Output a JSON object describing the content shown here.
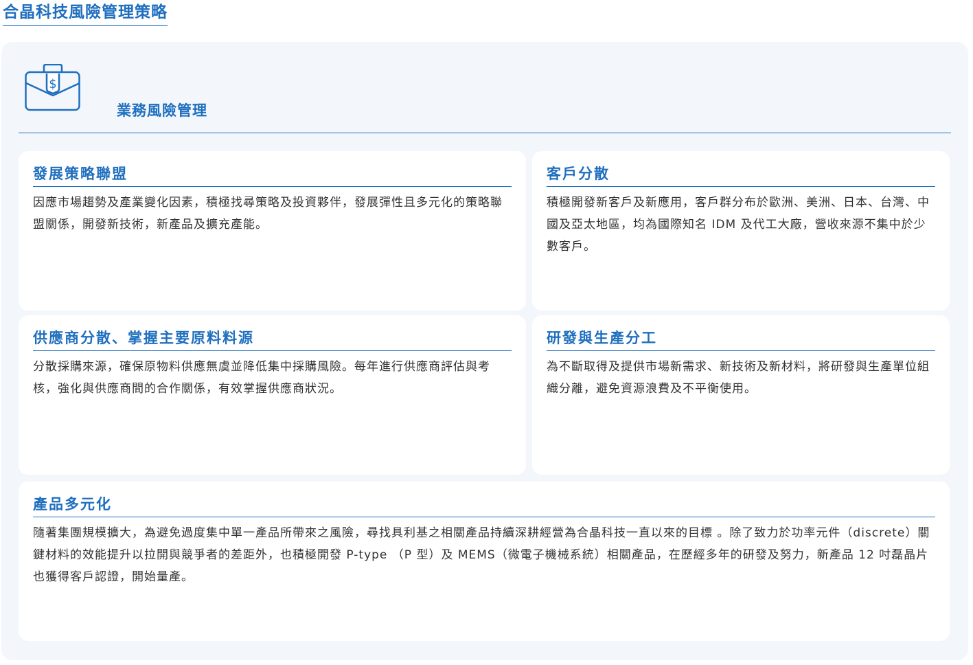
{
  "page": {
    "title": "合晶科技風險管理策略"
  },
  "section": {
    "label": "業務風險管理",
    "icon": "briefcase-dollar-icon"
  },
  "cards": [
    {
      "title": "發展策略聯盟",
      "body": "因應市場趨勢及產業變化因素，積極找尋策略及投資夥伴，發展彈性且多元化的策略聯盟關係，開發新技術，新產品及擴充產能。"
    },
    {
      "title": "客戶分散",
      "body": "積極開發新客戶及新應用，客戶群分布於歐洲、美洲、日本、台灣、中國及亞太地區，均為國際知名 IDM 及代工大廠，營收來源不集中於少數客戶。"
    },
    {
      "title": "供應商分散、掌握主要原料料源",
      "body": "分散採購來源，確保原物料供應無虞並降低集中採購風險。每年進行供應商評估與考核，強化與供應商間的合作關係，有效掌握供應商狀況。"
    },
    {
      "title": "研發與生產分工",
      "body": "為不斷取得及提供市場新需求、新技術及新材料，將研發與生產單位組織分離，避免資源浪費及不平衡使用。"
    },
    {
      "title": "產品多元化",
      "body": "隨著集團規模擴大，為避免過度集中單一產品所帶來之風險，尋找具利基之相關產品持續深耕經營為合晶科技一直以來的目標 。除了致力於功率元件（discrete）關鍵材料的效能提升以拉開與競爭者的差距外，也積極開發 P-type （P 型）及 MEMS（微電子機械系統）相關產品，在歷經多年的研發及努力，新產品 12 吋磊晶片也獲得客戶認證，開始量產。"
    }
  ],
  "colors": {
    "accent": "#1f6fbf",
    "panel": "#f3f7fb",
    "card": "#ffffff",
    "text": "#333333"
  }
}
